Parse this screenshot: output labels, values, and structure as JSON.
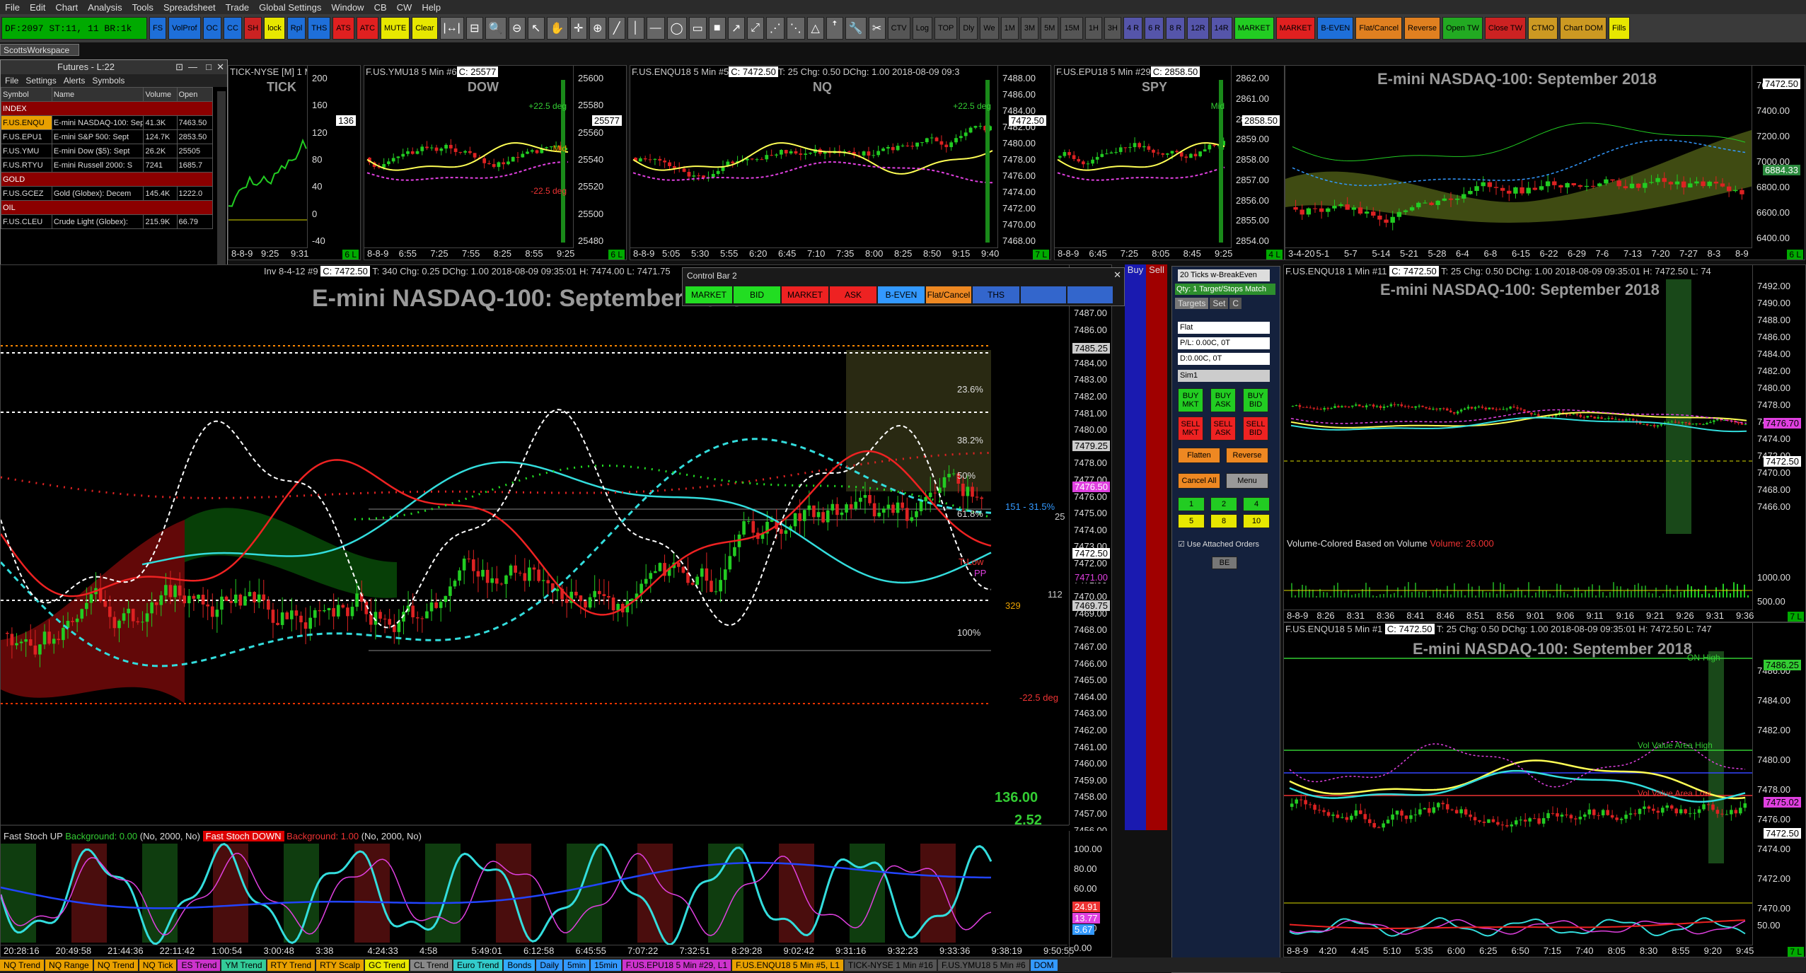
{
  "menu": [
    "File",
    "Edit",
    "Chart",
    "Analysis",
    "Tools",
    "Spreadsheet",
    "Trade",
    "Global Settings",
    "Window",
    "CB",
    "CW",
    "Help"
  ],
  "status_text": "DF:2097  ST:11, 11  BR:1k",
  "toolbar": {
    "buttons": [
      {
        "label": "FS",
        "bg": "#1e6fd9"
      },
      {
        "label": "VolProf",
        "bg": "#1e6fd9"
      },
      {
        "label": "OC",
        "bg": "#1e6fd9"
      },
      {
        "label": "CC",
        "bg": "#1e6fd9"
      },
      {
        "label": "SH",
        "bg": "#cc2222"
      },
      {
        "label": "lock",
        "bg": "#e7e700",
        "icon": "lock-icon"
      },
      {
        "label": "Rpl",
        "bg": "#1e6fd9"
      },
      {
        "label": "THS",
        "bg": "#1e6fd9"
      },
      {
        "label": "ATS",
        "bg": "#e02020"
      },
      {
        "label": "ATC",
        "bg": "#e02020"
      },
      {
        "label": "MUTE",
        "bg": "#e7e700"
      },
      {
        "label": "Clear",
        "bg": "#e7e700"
      }
    ],
    "tools": [
      "|↔|",
      "⊟",
      "🔍",
      "⊖",
      "↖",
      "✋",
      "✛",
      "⊕",
      "╱",
      "│",
      "—",
      "◯",
      "▭",
      "■",
      "↗",
      "⤢",
      "⋰",
      "⋱",
      "△",
      "ꜛ",
      "🔧",
      "✂"
    ],
    "buttons2": [
      {
        "label": "CTV",
        "bg": "#555"
      },
      {
        "label": "Log",
        "bg": "#555"
      },
      {
        "label": "TOP",
        "bg": "#555"
      },
      {
        "label": "Dly",
        "bg": "#555"
      },
      {
        "label": "We",
        "bg": "#555"
      },
      {
        "label": "1M",
        "bg": "#555"
      },
      {
        "label": "3M",
        "bg": "#555"
      },
      {
        "label": "5M",
        "bg": "#555"
      },
      {
        "label": "15M",
        "bg": "#555"
      },
      {
        "label": "1H",
        "bg": "#555"
      },
      {
        "label": "3H",
        "bg": "#555"
      },
      {
        "label": "4 R",
        "bg": "#5555aa"
      },
      {
        "label": "6 R",
        "bg": "#5555aa"
      },
      {
        "label": "8 R",
        "bg": "#5555aa"
      },
      {
        "label": "12R",
        "bg": "#5555aa"
      },
      {
        "label": "14R",
        "bg": "#5555aa"
      },
      {
        "label": "MARKET",
        "bg": "#22cc22"
      },
      {
        "label": "MARKET",
        "bg": "#e02020"
      },
      {
        "label": "B-EVEN",
        "bg": "#1e6fd9"
      },
      {
        "label": "Flat/Cancel",
        "bg": "#e08020"
      },
      {
        "label": "Reverse",
        "bg": "#e08020"
      },
      {
        "label": "Open TW",
        "bg": "#22aa22"
      },
      {
        "label": "Close TW",
        "bg": "#cc2222"
      },
      {
        "label": "CTMO",
        "bg": "#cc9922"
      },
      {
        "label": "Chart DOM",
        "bg": "#cc9922"
      },
      {
        "label": "Fills",
        "bg": "#e7e700"
      }
    ]
  },
  "workspace_tab": "ScottsWorkspace",
  "futures_window": {
    "title": "Futures - L:22",
    "menu": [
      "File",
      "Settings",
      "Alerts",
      "Symbols"
    ],
    "columns": [
      "Symbol",
      "Name",
      "Volume",
      "Open"
    ],
    "groups": [
      {
        "name": "INDEX",
        "rows": [
          [
            "F.US.ENQU",
            "E-mini NASDAQ-100: Sep",
            "41.3K",
            "7463.50"
          ],
          [
            "F.US.EPU1",
            "E-mini S&P 500: Sept",
            "124.7K",
            "2853.50"
          ],
          [
            "F.US.YMU",
            "E-mini Dow ($5): Sept",
            "26.2K",
            "25505"
          ],
          [
            "F.US.RTYU",
            "E-mini Russell 2000: S",
            "7241",
            "1685.7"
          ]
        ]
      },
      {
        "name": "GOLD",
        "rows": [
          [
            "F.US.GCEZ",
            "Gold (Globex): Decem",
            "145.4K",
            "1222.0"
          ]
        ]
      },
      {
        "name": "OIL",
        "rows": [
          [
            "F.US.CLEU",
            "Crude Light (Globex):",
            "215.9K",
            "66.79"
          ]
        ]
      }
    ]
  },
  "mini_charts": [
    {
      "hdr": "TICK-NYSE [M]  1 Min",
      "title": "TICK",
      "axis": [
        "200",
        "160",
        "120",
        "80",
        "40",
        "0",
        "-40"
      ],
      "label": "136",
      "label_bg": "#ffffff",
      "times": [
        "8-8-9",
        "9:25",
        "9:31"
      ],
      "bar_count": "6 L"
    },
    {
      "hdr": "F.US.YMU18  5 Min  #6",
      "price": "C: 25577",
      "title": "DOW",
      "axis": [
        "25600",
        "25580",
        "25560",
        "25540",
        "25520",
        "25500",
        "25480"
      ],
      "label": "25577",
      "label_bg": "#ffffff",
      "times": [
        "8-8-9",
        "6:55",
        "7:25",
        "7:55",
        "8:25",
        "8:55",
        "9:25"
      ],
      "bar_count": "6 L",
      "ann": [
        "+22.5 deg",
        "Mid",
        "-22.5 deg"
      ]
    },
    {
      "hdr": "F.US.ENQU18  5 Min  #5",
      "price": "C: 7472.50",
      "info": "T: 25  Chg: 0.50  DChg: 1.00  2018-08-09 09:3",
      "title": "NQ",
      "axis": [
        "7488.00",
        "7486.00",
        "7484.00",
        "7482.00",
        "7480.00",
        "7478.00",
        "7476.00",
        "7474.00",
        "7472.00",
        "7470.00",
        "7468.00"
      ],
      "label": "7472.50",
      "label_bg": "#ffffff",
      "times": [
        "8-8-9",
        "5:05",
        "5:30",
        "5:55",
        "6:20",
        "6:45",
        "7:10",
        "7:35",
        "8:00",
        "8:25",
        "8:50",
        "9:15",
        "9:40"
      ],
      "bar_count": "7 L",
      "ann": [
        "+22.5 deg"
      ]
    },
    {
      "hdr": "F.US.EPU18  5 Min  #29",
      "price": "C: 2858.50",
      "title": "SPY",
      "axis": [
        "2862.00",
        "2861.00",
        "2860.00",
        "2859.00",
        "2858.00",
        "2857.00",
        "2856.00",
        "2855.00",
        "2854.00"
      ],
      "label": "2858.50",
      "label_bg": "#ffffff",
      "times": [
        "8-8-9",
        "6:45",
        "7:25",
        "8:05",
        "8:45",
        "9:25"
      ],
      "bar_count": "4 L",
      "ann": [
        "Mid"
      ]
    },
    {
      "hdr": "",
      "title": "E-mini NASDAQ-100: September 2018",
      "axis": [
        "7600.00",
        "7400.00",
        "7200.00",
        "7000.00",
        "6800.00",
        "6600.00",
        "6400.00"
      ],
      "label": "7472.50",
      "label_bg": "#ffffff",
      "label2": "6884.33",
      "times": [
        "3-4-20",
        "5-1",
        "5-7",
        "5-14",
        "5-21",
        "5-28",
        "6-4",
        "6-8",
        "6-15",
        "6-22",
        "6-29",
        "7-6",
        "7-13",
        "7-20",
        "7-27",
        "8-3",
        "8-9"
      ],
      "bar_count": "6 L"
    }
  ],
  "main_chart": {
    "hdr": "Inv 8-4-12  #9",
    "price": "C: 7472.50",
    "info": "T: 340  Chg: 0.25  DChg: 1.00  2018-08-09 09:35:01  H: 7474.00  L: 7471.75",
    "title": "E-mini NASDAQ-100: September 2018",
    "axis": [
      "7487.00",
      "7486.00",
      "7485.00",
      "7484.00",
      "7483.00",
      "7482.00",
      "7481.00",
      "7480.00",
      "7479.00",
      "7478.00",
      "7477.00",
      "7476.00",
      "7475.00",
      "7474.00",
      "7473.00",
      "7472.00",
      "7471.00",
      "7470.00",
      "7469.00",
      "7468.00",
      "7467.00",
      "7466.00",
      "7465.00",
      "7464.00",
      "7463.00",
      "7462.00",
      "7461.00",
      "7460.00",
      "7459.00",
      "7458.00",
      "7457.00",
      "7456.00"
    ],
    "fib": [
      "23.6%",
      "38.2%",
      "50%",
      "61.8%",
      "100%"
    ],
    "labels": {
      "p1": "7485.25",
      "p2": "7479.25",
      "p3": "7476.50",
      "p4": "7472.50",
      "p5": "7469.75",
      "p6": "7471.00"
    },
    "ann": {
      "deg": "-22.5 deg",
      "angle": "151 - 31.5%",
      "tlow": "T-Low",
      "pp": "PP",
      "n25": "25",
      "n329": "329",
      "n112": "112"
    },
    "readout1": "136.00",
    "readout2": "2.52",
    "stoch_legend": {
      "a": "Fast Stoch UP",
      "a2": "Background: 0.00",
      "a3": "(No, 2000, No)",
      "b": "Fast Stoch DOWN",
      "b2": "Background: 1.00",
      "b3": "(No, 2000, No)"
    },
    "stoch_axis": [
      "100.00",
      "80.00",
      "60.00",
      "40.00",
      "20.00",
      "0.00"
    ],
    "stoch_labels": [
      "24.91",
      "13.77",
      "5.67"
    ],
    "times": [
      "20:28:16",
      "20:49:58",
      "21:44:36",
      "22:11:42",
      "1:00:54",
      "3:00:48",
      "3:38",
      "4:24:33",
      "4:58",
      "5:49:01",
      "6:12:58",
      "6:45:55",
      "7:07:22",
      "7:32:51",
      "8:29:28",
      "9:02:42",
      "9:31:16",
      "9:32:23",
      "9:33:36",
      "9:38:19",
      "9:50:55"
    ]
  },
  "control_bar": {
    "title": "Control Bar 2",
    "buttons": [
      {
        "label": "MARKET",
        "bg": "#22dd22"
      },
      {
        "label": "BID",
        "bg": "#22dd22"
      },
      {
        "label": "MARKET",
        "bg": "#ee2222"
      },
      {
        "label": "ASK",
        "bg": "#ee2222"
      },
      {
        "label": "B-EVEN",
        "bg": "#3399ff"
      },
      {
        "label": "Flat/Cancel",
        "bg": "#ee8822"
      },
      {
        "label": "THS",
        "bg": "#3366cc"
      },
      {
        "label": "",
        "bg": "#3366cc"
      },
      {
        "label": "",
        "bg": "#3366cc"
      }
    ]
  },
  "dom": {
    "buy": "Buy",
    "sell": "Sell"
  },
  "order_entry": {
    "dropdown": "20 Ticks w-BreakEven",
    "qty": "Qty: 1 Target/Stops Match",
    "tabs": [
      "Targets",
      "Set",
      "C"
    ],
    "fields": [
      "Flat",
      "P/L: 0.00C, 0T",
      "D:0.00C, 0T",
      "Sim1"
    ],
    "buttons": [
      {
        "label": "BUY MKT",
        "bg": "#22cc22"
      },
      {
        "label": "BUY ASK",
        "bg": "#22cc22"
      },
      {
        "label": "BUY BID",
        "bg": "#22cc22"
      },
      {
        "label": "SELL MKT",
        "bg": "#ee2222"
      },
      {
        "label": "SELL ASK",
        "bg": "#ee2222"
      },
      {
        "label": "SELL BID",
        "bg": "#ee2222"
      }
    ],
    "flatten": "Flatten",
    "reverse": "Reverse",
    "cancel_all": "Cancel All",
    "menu": "Menu",
    "qty_buttons": [
      "1",
      "2",
      "4",
      "5",
      "8",
      "10"
    ],
    "attached": "Use Attached Orders",
    "be": "BE"
  },
  "right_top": {
    "hdr": "F.US.ENQU18  1 Min  #11",
    "price": "C: 7472.50",
    "info": "T: 25  Chg: 0.50  DChg: 1.00  2018-08-09 09:35:01  H: 7472.50  L: 74",
    "title": "E-mini NASDAQ-100: September 2018",
    "axis": [
      "7492.00",
      "7490.00",
      "7488.00",
      "7486.00",
      "7484.00",
      "7482.00",
      "7480.00",
      "7478.00",
      "7476.00",
      "7474.00",
      "7472.00",
      "7470.00",
      "7468.00",
      "7466.00",
      "1000.00",
      "500.00"
    ],
    "vol_text": "Volume-Colored Based on Volume",
    "vol_val": "Volume: 26.000",
    "label1": "7476.70",
    "label2": "7472.50",
    "times": [
      "8-8-9",
      "8:26",
      "8:31",
      "8:36",
      "8:41",
      "8:46",
      "8:51",
      "8:56",
      "9:01",
      "9:06",
      "9:11",
      "9:16",
      "9:21",
      "9:26",
      "9:31",
      "9:36"
    ],
    "bar_count": "7 L"
  },
  "right_bottom": {
    "hdr": "F.US.ENQU18  5 Min  #1",
    "price": "C: 7472.50",
    "info": "T: 25  Chg: 0.50  DChg: 1.00  2018-08-09 09:35:01  H: 7472.50  L: 747",
    "title": "E-mini NASDAQ-100: September 2018",
    "axis": [
      "7486.00",
      "7484.00",
      "7482.00",
      "7480.00",
      "7478.00",
      "7476.00",
      "7474.00",
      "7472.00",
      "7470.00",
      "50.00"
    ],
    "ann": [
      "ON-High",
      "Vol Value Area High",
      "Vol Value Area Low"
    ],
    "label1": "7486.25",
    "label2": "7475.02",
    "label3": "7472.50",
    "times": [
      "8-8-9",
      "4:20",
      "4:45",
      "5:10",
      "5:35",
      "6:00",
      "6:25",
      "6:50",
      "7:15",
      "7:40",
      "8:05",
      "8:30",
      "8:55",
      "9:20",
      "9:45"
    ],
    "bar_count": "7 L"
  },
  "bottom_tabs": [
    {
      "label": "NQ Trend",
      "bg": "#e8a000"
    },
    {
      "label": "NQ Range",
      "bg": "#e8a000"
    },
    {
      "label": "NQ Trend",
      "bg": "#e8a000"
    },
    {
      "label": "NQ Tick",
      "bg": "#e8a000"
    },
    {
      "label": "ES Trend",
      "bg": "#cc33cc"
    },
    {
      "label": "YM Trend",
      "bg": "#33cc99"
    },
    {
      "label": "RTY Trend",
      "bg": "#e8a000"
    },
    {
      "label": "RTY Scalp",
      "bg": "#e8a000"
    },
    {
      "label": "GC Trend",
      "bg": "#e7e700"
    },
    {
      "label": "CL Trend",
      "bg": "#888888"
    },
    {
      "label": "Euro Trend",
      "bg": "#33cccc"
    },
    {
      "label": "Bonds",
      "bg": "#33aaff"
    },
    {
      "label": "Daily",
      "bg": "#3399ff"
    },
    {
      "label": "5min",
      "bg": "#3399ff"
    },
    {
      "label": "15min",
      "bg": "#3399ff"
    },
    {
      "label": "F.US.EPU18  5 Min  #29, L1",
      "bg": "#cc33cc"
    },
    {
      "label": "F.US.ENQU18  5 Min  #5, L1",
      "bg": "#e8a000"
    },
    {
      "label": "TICK-NYSE  1 Min  #16",
      "bg": "#555555"
    },
    {
      "label": "F.US.YMU18  5 Min  #6",
      "bg": "#555555"
    },
    {
      "label": "DOM",
      "bg": "#3399ff"
    }
  ]
}
